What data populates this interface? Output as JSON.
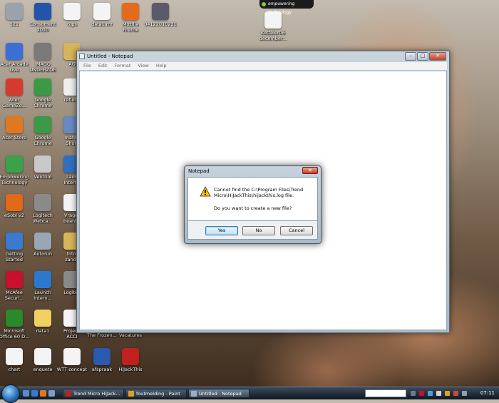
{
  "desktop_icons": [
    {
      "label": "321",
      "color": "#9aa2aa"
    },
    {
      "label": "Consument\n2010",
      "color": "#2255aa"
    },
    {
      "label": "6.ps",
      "color": "#f4f4f4"
    },
    {
      "label": "data1.mr",
      "color": "#f4f4f4"
    },
    {
      "label": "Mozilla\nFirefox",
      "color": "#e56a1c"
    },
    {
      "label": "04122010231",
      "color": "#5a5a6a"
    },
    {
      "label": "Acer Arcade\nLive",
      "color": "#3b6fd4"
    },
    {
      "label": "IMAGO\nUNDERZOE",
      "color": "#7a7a7a"
    },
    {
      "label": "AG",
      "color": "#d8b45a"
    },
    {
      "label": "Acer\nGameZo...",
      "color": "#d43b2c"
    },
    {
      "label": "Google\nChrome",
      "color": "#3a9a45"
    },
    {
      "label": "reflecti",
      "color": "#eeeeee"
    },
    {
      "label": "Acer Store",
      "color": "#e07820"
    },
    {
      "label": "Google\nChrome",
      "color": "#3a9a45"
    },
    {
      "label": "mahm\nShort",
      "color": "#6a88c0"
    },
    {
      "label": "Empowering\nTechnology",
      "color": "#3aa24a"
    },
    {
      "label": "Ventrilo",
      "color": "#c8c8c8"
    },
    {
      "label": "Laun\nInterne",
      "color": "#3070c0"
    },
    {
      "label": "eSobi v2",
      "color": "#e06a1a"
    },
    {
      "label": "Logitech\nWebca...",
      "color": "#8a8a8a"
    },
    {
      "label": "Vrager\nbeantw",
      "color": "#f4f4f4"
    },
    {
      "label": "Getting\nStarted",
      "color": "#3a7ad0"
    },
    {
      "label": "Autorun",
      "color": "#9aa6b4"
    },
    {
      "label": "fotol\nzandv",
      "color": "#d8b45a"
    },
    {
      "label": "McAfee\nSecuri...",
      "color": "#c8102e"
    },
    {
      "label": "Launch\nIntern...",
      "color": "#2a78d0"
    },
    {
      "label": "Logitec",
      "color": "#8a8a8a"
    },
    {
      "label": "Microsoft\nOffice 60 D...",
      "color": "#2a8a2a"
    },
    {
      "label": "data1",
      "color": "#f0d060"
    },
    {
      "label": "Projecti\nACCI",
      "color": "#f4f4f4"
    },
    {
      "label": "chart",
      "color": "#f4f4f4"
    },
    {
      "label": "enquete",
      "color": "#f4f4f4"
    },
    {
      "label": "WTT concept",
      "color": "#f4f4f4"
    },
    {
      "label": "afspraak",
      "color": "#2a5ab0"
    },
    {
      "label": "HiJackThis",
      "color": "#c0201e"
    },
    {
      "label": "The Frozen...",
      "color": "#5a4a3a"
    },
    {
      "label": "Vacatures",
      "color": "#f4f4f4"
    },
    {
      "label": "Kotteler06\ndecember...",
      "color": "#f4f4f4"
    }
  ],
  "gadget": {
    "label": "empowering technology"
  },
  "notepad": {
    "title": "Untitled - Notepad",
    "menu": [
      "File",
      "Edit",
      "Format",
      "View",
      "Help"
    ],
    "controls": {
      "minimize": "–",
      "maximize": "□",
      "close": "✕"
    }
  },
  "dialog": {
    "title": "Notepad",
    "close": "✕",
    "message": "Cannot find the C:\\Program Files\\Trend\nMicro\\HiJackThis\\hijackthis.log file.",
    "question": "Do you want to create a new file?",
    "buttons": {
      "yes": "Yes",
      "no": "No",
      "cancel": "Cancel"
    }
  },
  "taskbar": {
    "items": [
      {
        "label": "Trend Micro HiJack...",
        "icon_color": "#c0201e",
        "active": false
      },
      {
        "label": "foutmelding - Paint",
        "icon_color": "#e0a020",
        "active": false
      },
      {
        "label": "Untitled - Notepad",
        "icon_color": "#9ab0c8",
        "active": true
      }
    ],
    "clock": "07:11"
  }
}
